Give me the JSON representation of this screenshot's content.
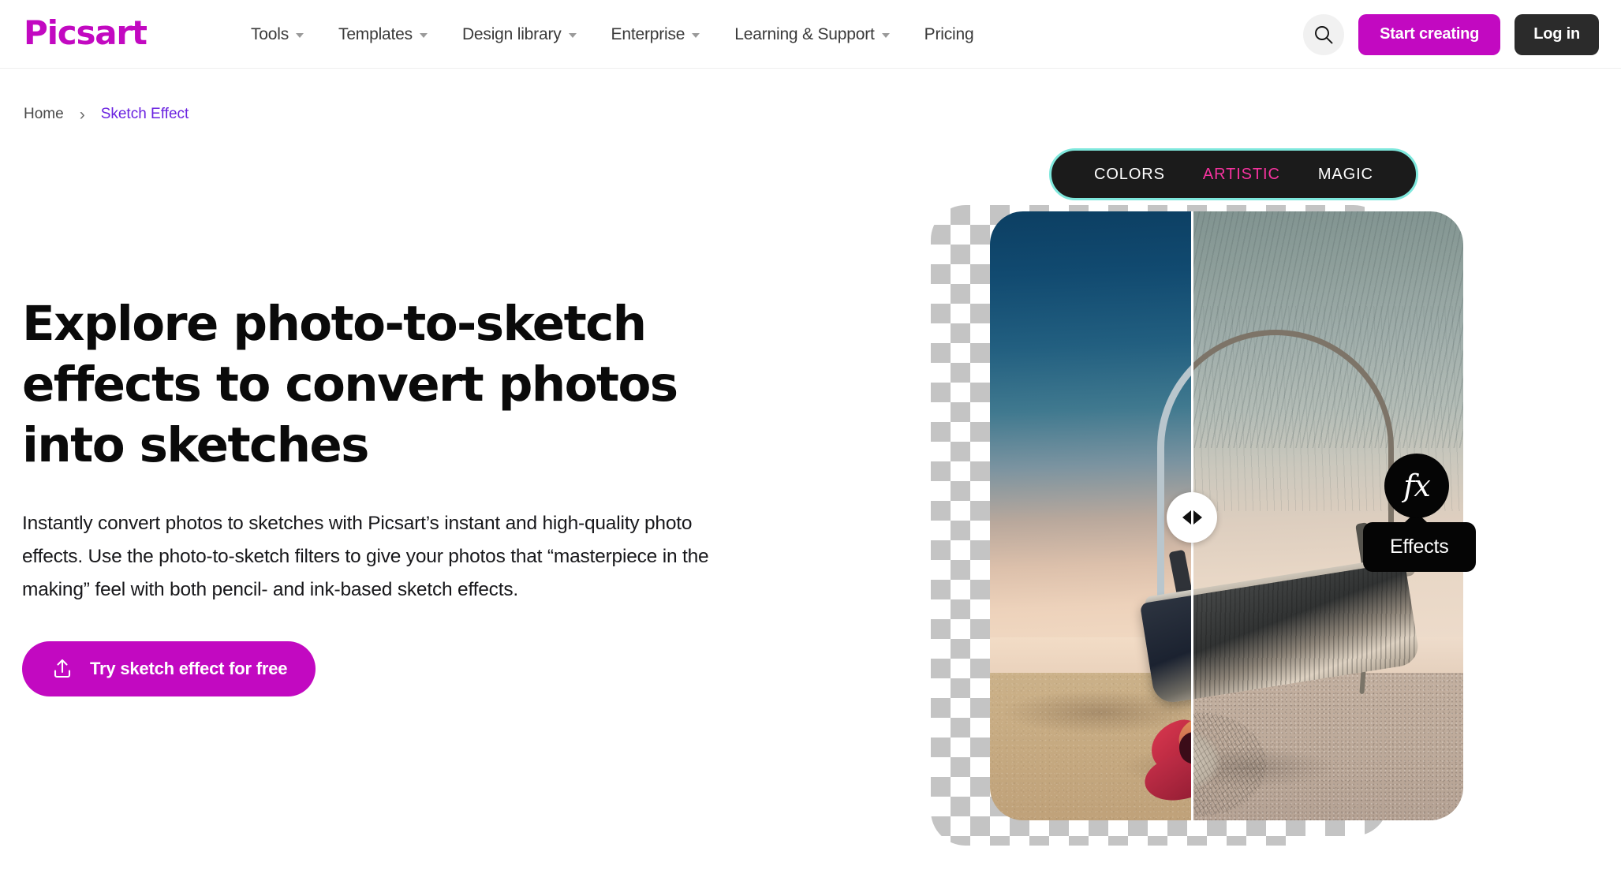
{
  "brand": {
    "logo_text": "Picsart",
    "magenta": "#C209C1",
    "dark": "#2b2b2b",
    "link_purple": "#6a22e0",
    "pill_border_teal": "#7FE8DD",
    "pill_selected_pink": "#F6339F"
  },
  "header": {
    "nav": [
      {
        "label": "Tools",
        "has_caret": true
      },
      {
        "label": "Templates",
        "has_caret": true
      },
      {
        "label": "Design library",
        "has_caret": true
      },
      {
        "label": "Enterprise",
        "has_caret": true
      },
      {
        "label": "Learning & Support",
        "has_caret": true
      },
      {
        "label": "Pricing",
        "has_caret": false
      }
    ],
    "search_icon": "search-icon",
    "start_creating_label": "Start creating",
    "login_label": "Log in"
  },
  "breadcrumb": {
    "home_label": "Home",
    "separator": "›",
    "current_label": "Sketch Effect"
  },
  "hero": {
    "title": "Explore photo-to-sketch effects to convert photos into sketches",
    "description": "Instantly convert photos to sketches with Picsart’s instant and high-quality photo effects. Use the photo-to-sketch filters to give your photos that “masterpiece in the making” feel with both pencil- and ink-based sketch effects.",
    "cta_label": "Try sketch effect for free",
    "cta_icon": "upload-icon"
  },
  "editor_preview": {
    "toolbar_tabs": [
      {
        "label": "COLORS",
        "selected": false
      },
      {
        "label": "ARTISTIC",
        "selected": true
      },
      {
        "label": "MAGIC",
        "selected": false
      }
    ],
    "compare_slider": {
      "icon": "compare-arrows-icon",
      "position_percent": 42
    },
    "effects_badge": {
      "icon": "fx-icon",
      "glyph": "fx"
    },
    "effects_tooltip_label": "Effects"
  }
}
